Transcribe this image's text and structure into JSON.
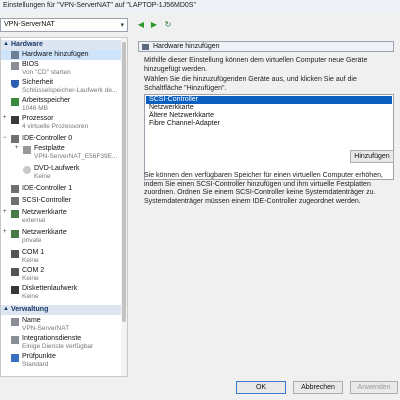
{
  "window": {
    "title": "Einstellungen für \"VPN-ServerNAT\" auf \"LAPTOP-1J56MD0S\""
  },
  "vm_selector": {
    "value": "VPN-ServerNAT"
  },
  "sidebar": {
    "hardware_label": "Hardware",
    "management_label": "Verwaltung",
    "items": [
      {
        "name": "Hardware hinzufügen",
        "sub": ""
      },
      {
        "name": "BIOS",
        "sub": "Von \"CD\" starten"
      },
      {
        "name": "Sicherheit",
        "sub": "Schlüsselspeicher-Laufwerk de..."
      },
      {
        "name": "Arbeitsspeicher",
        "sub": "1046 MB"
      },
      {
        "name": "Prozessor",
        "sub": "4 virtuelle Prozessoren"
      },
      {
        "name": "IDE-Controller 0",
        "sub": ""
      },
      {
        "name": "Festplatte",
        "sub": "VPN-ServerNAT_E56F39E..."
      },
      {
        "name": "DVD-Laufwerk",
        "sub": "Keine"
      },
      {
        "name": "IDE-Controller 1",
        "sub": ""
      },
      {
        "name": "SCSI-Controller",
        "sub": ""
      },
      {
        "name": "Netzwerkkarte",
        "sub": "external"
      },
      {
        "name": "Netzwerkkarte",
        "sub": "private"
      },
      {
        "name": "COM 1",
        "sub": "Keine"
      },
      {
        "name": "COM 2",
        "sub": "Keine"
      },
      {
        "name": "Diskettenlaufwerk",
        "sub": "Keine"
      },
      {
        "name": "Name",
        "sub": "VPN-ServerNAT"
      },
      {
        "name": "Integrationsdienste",
        "sub": "Einige Dienste verfügbar"
      },
      {
        "name": "Prüfpunkte",
        "sub": "Standard"
      }
    ]
  },
  "panel": {
    "title": "Hardware hinzufügen",
    "intro": "Mithilfe dieser Einstellung können dem virtuellen Computer neue Geräte hinzugefügt werden.",
    "instruction": "Wählen Sie die hinzuzufügenden Geräte aus, und klicken Sie auf die Schaltfläche \"Hinzufügen\".",
    "devices": [
      "SCSI-Controller",
      "Netzwerkkarte",
      "Ältere Netzwerkkarte",
      "Fibre Channel-Adapter"
    ],
    "selected_device": "SCSI-Controller",
    "add_button": "Hinzufügen",
    "description": "Sie können den verfügbaren Speicher für einen virtuellen Computer erhöhen, indem Sie einen SCSI-Controller hinzufügen und ihm virtuelle Festplatten zuordnen. Ordnen Sie einem SCSI-Controller keine Systemdatenträger zu. Systemdatenträger müssen einem IDE-Controller zugeordnet werden."
  },
  "footer": {
    "ok": "OK",
    "cancel": "Abbrechen",
    "apply": "Anwenden"
  },
  "colors": {
    "selection": "#0a5fbf",
    "section_bg": "#dde6f0"
  }
}
